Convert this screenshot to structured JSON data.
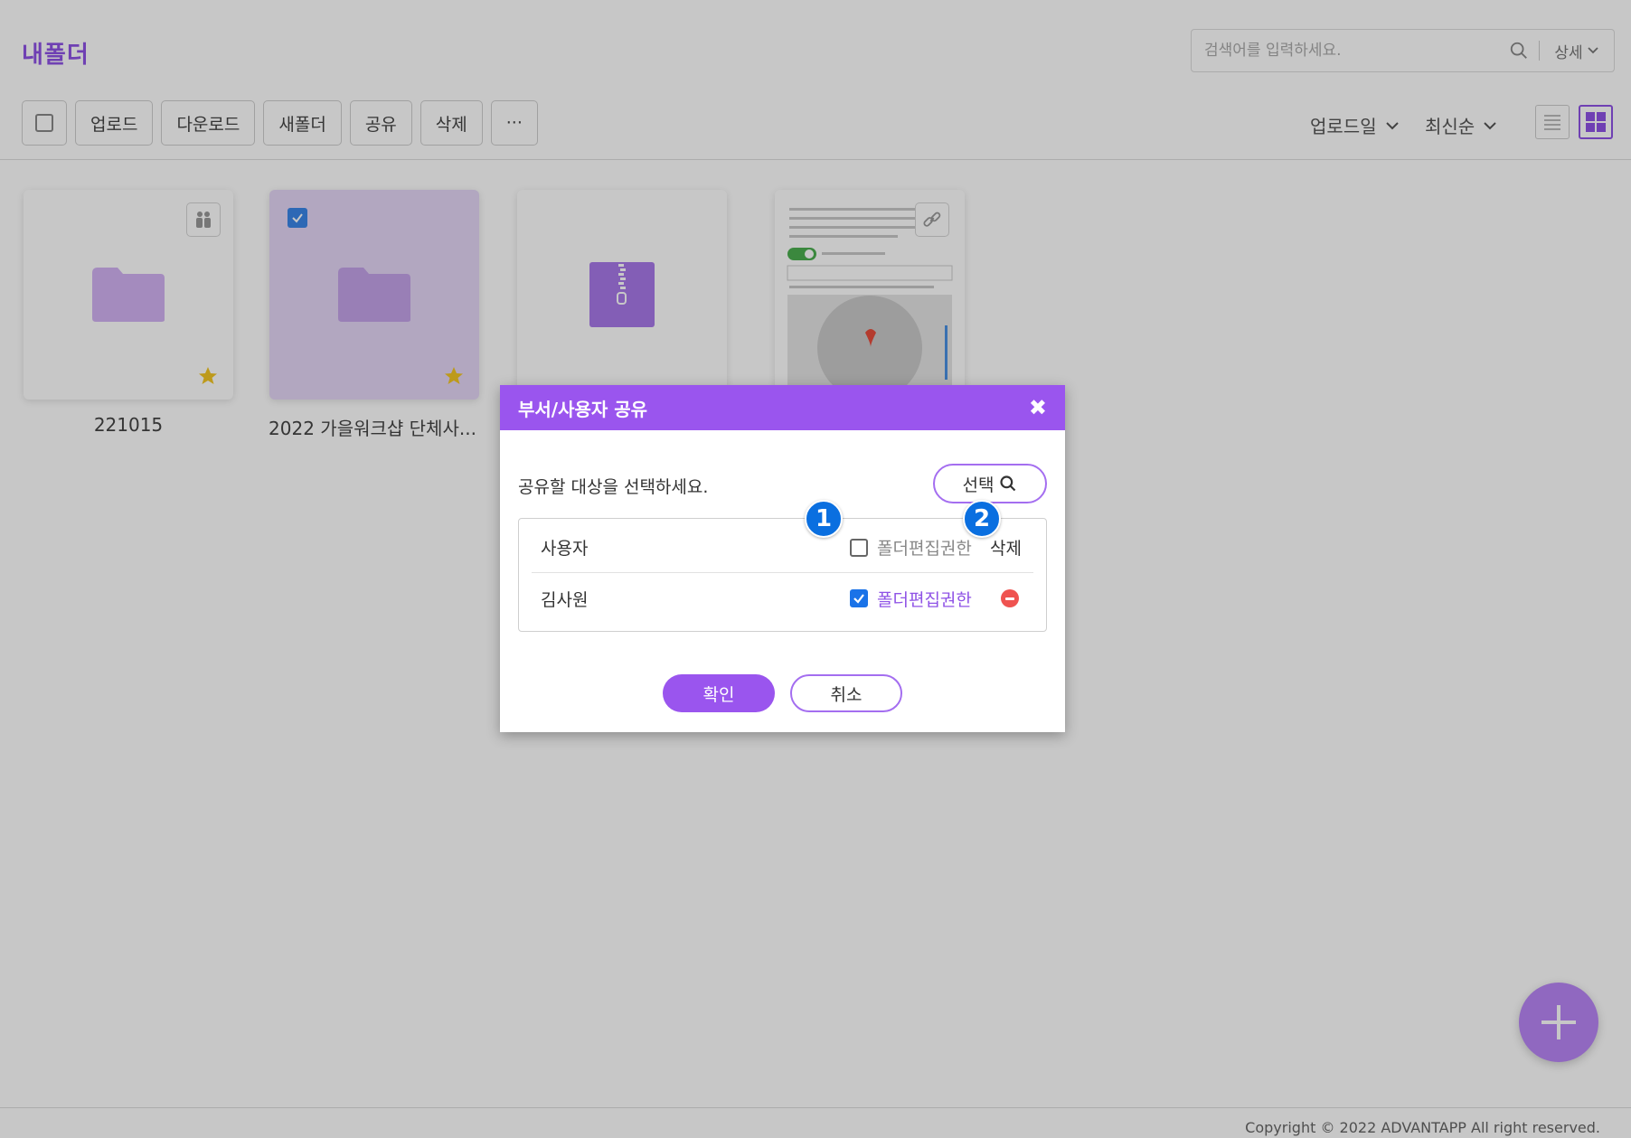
{
  "page": {
    "title": "내폴더"
  },
  "search": {
    "placeholder": "검색어를 입력하세요.",
    "detail_label": "상세"
  },
  "toolbar": {
    "upload": "업로드",
    "download": "다운로드",
    "new_folder": "새폴더",
    "share": "공유",
    "delete": "삭제",
    "more": "···"
  },
  "sort": {
    "field": "업로드일",
    "order": "최신순"
  },
  "items": [
    {
      "name": "221015",
      "type": "shared-folder",
      "starred": true,
      "selected": false
    },
    {
      "name": "2022 가을워크샵 단체사...",
      "type": "folder",
      "starred": true,
      "selected": true
    },
    {
      "name": "",
      "type": "zip-file",
      "starred": false,
      "selected": false
    },
    {
      "name": "",
      "type": "document-link",
      "starred": false,
      "selected": false
    }
  ],
  "modal": {
    "title": "부서/사용자 공유",
    "close": "✖",
    "prompt": "공유할 대상을 선택하세요.",
    "select_button": "선택",
    "header": {
      "user": "사용자",
      "perm": "폴더편집권한",
      "delete": "삭제"
    },
    "rows": [
      {
        "user": "김사원",
        "perm": "폴더편집권한",
        "perm_checked": true
      }
    ],
    "annotations": [
      "1",
      "2"
    ],
    "confirm": "확인",
    "cancel": "취소"
  },
  "footer": {
    "copyright": "Copyright © 2022 ADVANTAPP All right reserved."
  },
  "colors": {
    "accent": "#9a55ee",
    "badge": "#0a6fe0",
    "delete": "#ef5350"
  }
}
